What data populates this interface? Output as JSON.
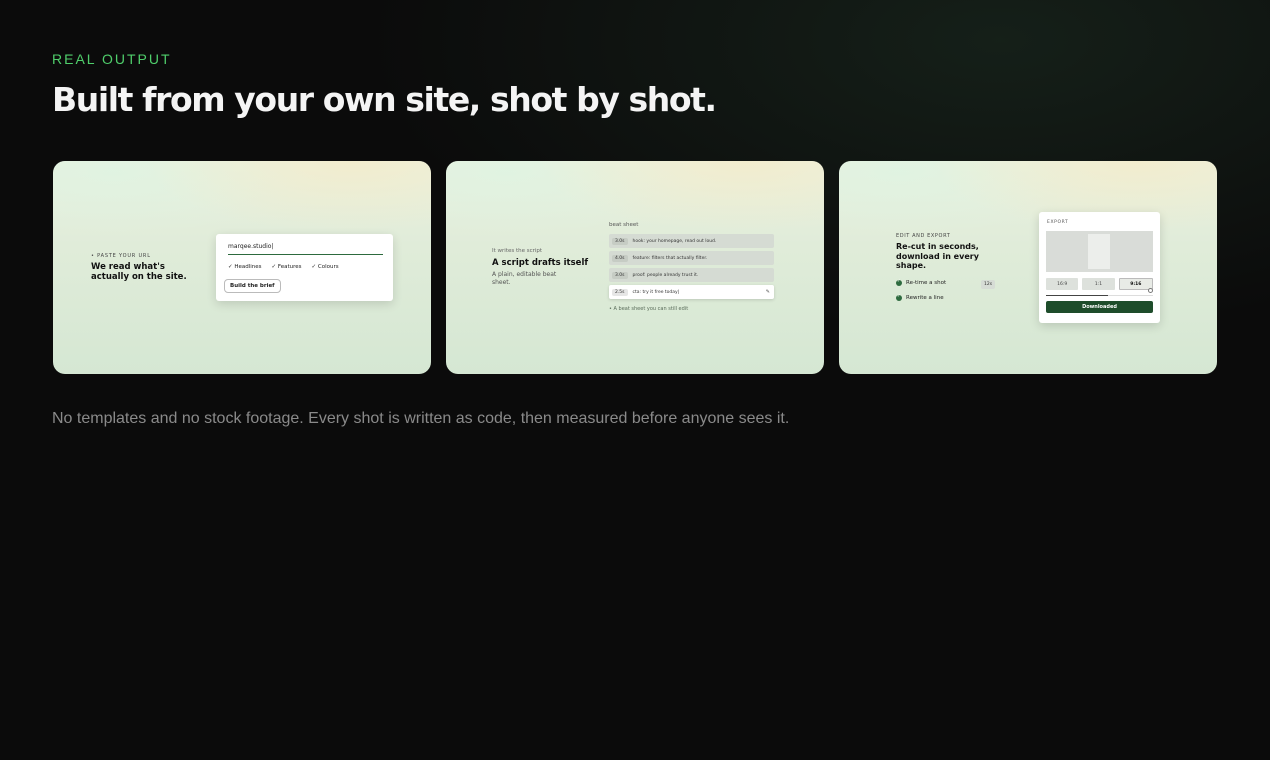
{
  "section": {
    "eyebrow": "REAL OUTPUT",
    "headline": "Built from your own site, shot by shot.",
    "footnote": "No templates and no stock footage. Every shot is written as code, then measured before anyone sees it."
  },
  "cards": [
    {
      "tag": "• PASTE YOUR URL",
      "title": "We read what's actually on the site.",
      "url_input": "marqee.studio|",
      "checks": [
        "✓ Headlines",
        "✓ Features",
        "✓ Colours"
      ],
      "button": "Build the brief"
    },
    {
      "tag": "It writes the script",
      "title": "A script drafts itself",
      "subtitle": "A plain, editable beat sheet.",
      "list_label": "beat sheet",
      "rows": [
        {
          "duration": "3.0s",
          "text": "hook: your homepage, read out loud."
        },
        {
          "duration": "4.0s",
          "text": "feature: filters that actually filter."
        },
        {
          "duration": "3.0s",
          "text": "proof: people already trust it."
        },
        {
          "duration": "2.5s",
          "text": "cta: try it free today|"
        }
      ],
      "edit_icon": "pencil-icon",
      "caption": "• A beat sheet you can still edit"
    },
    {
      "tag": "EDIT AND EXPORT",
      "title": "Re-cut in seconds, download in every shape.",
      "items": [
        "Re-time a shot",
        "Rewrite a line"
      ],
      "badge": "12s",
      "panel_title": "EXPORT",
      "ratios": [
        "16:9",
        "1:1",
        "9:16"
      ],
      "selected_ratio": "9:16",
      "progress": 0.58,
      "button": "Downloaded"
    }
  ]
}
